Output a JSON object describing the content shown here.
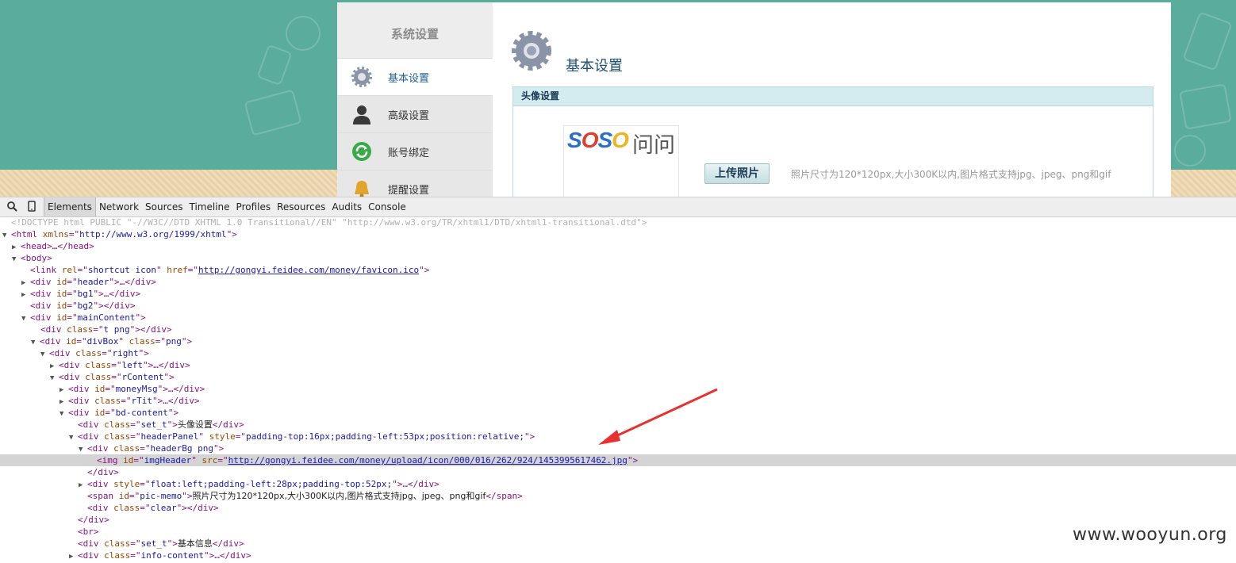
{
  "app": {
    "sidebar": {
      "title": "系统设置",
      "items": [
        {
          "label": "基本设置",
          "icon": "gear-icon"
        },
        {
          "label": "高级设置",
          "icon": "user-silhouette-icon"
        },
        {
          "label": "账号绑定",
          "icon": "refresh-icon"
        },
        {
          "label": "提醒设置",
          "icon": "bell-icon"
        }
      ]
    },
    "content": {
      "title": "基本设置",
      "panel_title": "头像设置",
      "avatar_logo": "SOSO",
      "avatar_logo_suffix": "问问",
      "upload_label": "上传照片",
      "memo": "照片尺寸为120*120px,大小300K以内,图片格式支持jpg、jpeg、png和gif"
    }
  },
  "devtools": {
    "tabs": [
      "Elements",
      "Network",
      "Sources",
      "Timeline",
      "Profiles",
      "Resources",
      "Audits",
      "Console"
    ],
    "selected_tab": "Elements"
  },
  "dom": {
    "doctype": "<!DOCTYPE html PUBLIC \"-//W3C//DTD XHTML 1.0 Transitional//EN\" \"http://www.w3.org/TR/xhtml1/DTD/xhtml1-transitional.dtd\">",
    "html_xmlns": "http://www.w3.org/1999/xhtml",
    "favicon_url": "http://gongyi.feidee.com/money/favicon.ico",
    "img_src": "http://gongyi.feidee.com/money/upload/icon/000/016/262/924/1453995617462.jpg",
    "set_t_1": "头像设置",
    "set_t_2": "基本信息",
    "memo_text": "照片尺寸为120*120px,大小300K以内,图片格式支持jpg、jpeg、png和gif",
    "header_panel_style": "padding-top:16px;padding-left:53px;position:relative;",
    "float_style": "float:left;padding-left:28px;padding-top:52px;"
  },
  "watermark": "www.wooyun.org",
  "colors": {
    "page_bg": "#5aac9c",
    "highlight_row": "#d4d4d4",
    "arrow": "#e8312f"
  }
}
